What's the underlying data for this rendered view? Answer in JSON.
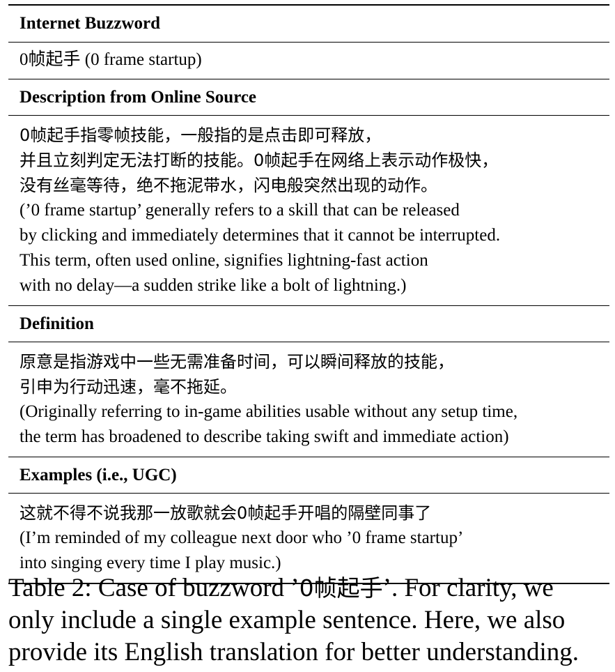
{
  "table": {
    "rows": [
      {
        "heading": "Internet Buzzword",
        "lines": [
          {
            "text": "0帧起手 (0 frame startup)",
            "lang": "mixed"
          }
        ]
      },
      {
        "heading": "Description from Online Source",
        "lines": [
          {
            "text": "0帧起手指零帧技能，一般指的是点击即可释放，",
            "lang": "zh"
          },
          {
            "text": "并且立刻判定无法打断的技能。0帧起手在网络上表示动作极快，",
            "lang": "zh"
          },
          {
            "text": "没有丝毫等待，绝不拖泥带水，闪电般突然出现的动作。",
            "lang": "zh"
          },
          {
            "text": "(’0 frame startup’ generally refers to a skill that can be released",
            "lang": "en"
          },
          {
            "text": "by clicking and immediately determines that it cannot be interrupted.",
            "lang": "en"
          },
          {
            "text": "This term, often used online, signifies lightning-fast action",
            "lang": "en"
          },
          {
            "text": "with no delay—a sudden strike like a bolt of lightning.)",
            "lang": "en"
          }
        ]
      },
      {
        "heading": "Definition",
        "lines": [
          {
            "text": "原意是指游戏中一些无需准备时间，可以瞬间释放的技能，",
            "lang": "zh"
          },
          {
            "text": "引申为行动迅速，毫不拖延。",
            "lang": "zh"
          },
          {
            "text": "(Originally referring to in-game abilities usable without any setup time,",
            "lang": "en"
          },
          {
            "text": "the term has broadened to describe taking swift and immediate action)",
            "lang": "en"
          }
        ]
      },
      {
        "heading": "Examples (i.e., UGC)",
        "lines": [
          {
            "text": "这就不得不说我那一放歌就会0帧起手开唱的隔壁同事了",
            "lang": "zh"
          },
          {
            "text": "(I’m reminded of my colleague next door who ’0 frame startup’",
            "lang": "en"
          },
          {
            "text": "into singing every time I play music.)",
            "lang": "en"
          }
        ]
      }
    ]
  },
  "caption": {
    "part1": "Table 2: Case of buzzword ’",
    "term": "0帧起手",
    "part2": "’. For clarity, we",
    "line2": "only include a single example sentence. Here, we also",
    "line3": "provide its English translation for better understanding."
  }
}
